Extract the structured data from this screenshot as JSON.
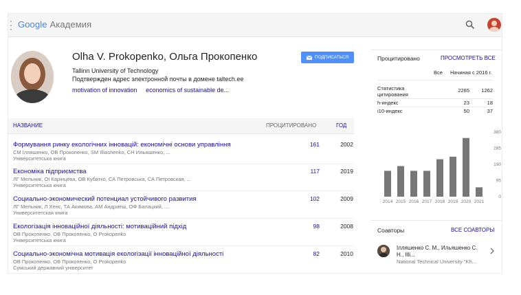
{
  "topbar": {
    "logo_google": "Google",
    "logo_academy": "Академия"
  },
  "profile": {
    "name": "Olha V. Prokopenko, Ольга Прокопенко",
    "affiliation": "Tallinn University of Technology",
    "verified": "Подтвержден адрес электронной почты в домене taltech.ee",
    "interests": [
      "motivation of innovation",
      "economics of sustainable de..."
    ],
    "subscribe_label": "ПОДПИСАТЬСЯ"
  },
  "table": {
    "col_title": "НАЗВАНИЕ",
    "col_cited": "ПРОЦИТИРОВАНО",
    "col_year": "ГОД",
    "rows": [
      {
        "title": "Формування ринку екологічних інновацій: економічні основи управління",
        "authors": "СМ Ілляшенко, ОВ Прокопенко, SM Illiashenko, СН Ильяшенко, ...",
        "venue": "Університетська книга",
        "cited": "161",
        "year": "2002"
      },
      {
        "title": "Економіка підприємства",
        "authors": "ЛГ Мельник, ОІ Карінцева, ОВ Кубатко, СА Петровська, СА Петровская, ...",
        "venue": "Університетська книга",
        "cited": "117",
        "year": "2019"
      },
      {
        "title": "Социально-экономический потенциал устойчивого развития",
        "authors": "ЛГ Мельник, Л Хенс, ТА Акимова, АМ Андриеш, ОФ Балацкий, ...",
        "venue": "Университетская книга",
        "cited": "102",
        "year": "2009"
      },
      {
        "title": "Екологізація інноваційної діяльності: мотиваційний підхід",
        "authors": "ОВ Прокопенко, ОВ Прокопенко, О Prokopenko",
        "venue": "Університетська книга",
        "cited": "98",
        "year": "2008"
      },
      {
        "title": "Социально-экономічна мотивація екологізації інноваційної діяльності",
        "authors": "ОВ Прокопенко, ОВ Прокопенко, О Prokopenko",
        "venue": "Сумський державний університет",
        "cited": "82",
        "year": "2010"
      }
    ]
  },
  "cited_panel": {
    "title": "Процитировано",
    "view_all": "ПРОСМОТРЕТЬ ВСЕ",
    "col_all": "Все",
    "col_since": "Начиная с 2016 г.",
    "stats": [
      {
        "label": "Статистика цитирования",
        "all": "2265",
        "since": "1262"
      },
      {
        "label": "h-индекс",
        "all": "23",
        "since": "18"
      },
      {
        "label": "i10-индекс",
        "all": "50",
        "since": "37"
      }
    ]
  },
  "chart_data": {
    "type": "bar",
    "categories": [
      "2014",
      "2015",
      "2016",
      "2017",
      "2018",
      "2019",
      "2020",
      "2021"
    ],
    "values": [
      152,
      180,
      152,
      152,
      220,
      235,
      345,
      55
    ],
    "yticks": [
      "380",
      "285",
      "190",
      "95",
      "0"
    ],
    "ylim": [
      0,
      380
    ],
    "bar_color": "#777777",
    "grid": false
  },
  "coauthors": {
    "title": "Соавторы",
    "view_all": "ВСЕ СОАВТОРЫ",
    "items": [
      {
        "name": "Ілляшенко С. М., Ильяшенко С. Н., Illi...",
        "affiliation": "National Technical University \"Kh..."
      }
    ]
  }
}
